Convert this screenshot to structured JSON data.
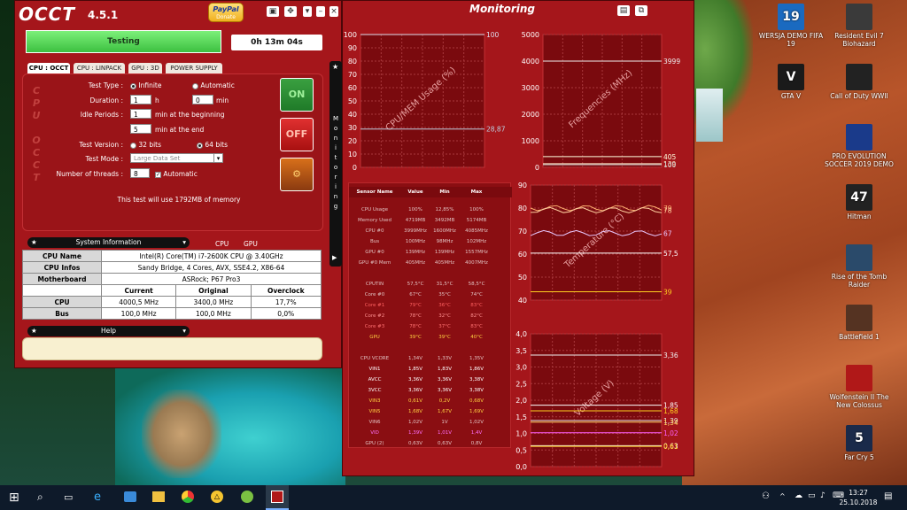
{
  "app": {
    "logo": "OCCT",
    "version": "4.5.1",
    "paypal_top": "PayPal",
    "paypal_bottom": "Donate"
  },
  "status": {
    "test_button": "Testing",
    "timer": "0h 13m 04s"
  },
  "tabs": [
    "CPU : OCCT",
    "CPU : LINPACK",
    "GPU : 3D",
    "POWER SUPPLY"
  ],
  "vertical_label": [
    "C",
    "P",
    "U",
    "",
    "O",
    "C",
    "C",
    "T"
  ],
  "form": {
    "test_type_label": "Test Type :",
    "infinite": "Infinite",
    "automatic": "Automatic",
    "duration_label": "Duration :",
    "duration_h": "1",
    "h": "h",
    "duration_min": "0",
    "min": "min",
    "idle_label": "Idle Periods :",
    "idle_begin": "1",
    "idle_begin_text": "min at the beginning",
    "idle_end": "5",
    "idle_end_text": "min at the end",
    "version_label": "Test Version :",
    "bits32": "32 bits",
    "bits64": "64 bits",
    "mode_label": "Test Mode :",
    "mode_value": "Large Data Set",
    "threads_label": "Number of threads :",
    "threads_value": "8",
    "threads_auto": "Automatic",
    "memory_note": "This test will use 1792MB of memory"
  },
  "buttons": {
    "on": "ON",
    "off": "OFF"
  },
  "monitoring_strip": [
    "M",
    "o",
    "n",
    "i",
    "t",
    "o",
    "r",
    "i",
    "n",
    "g"
  ],
  "sysinfo": {
    "title": "System Information",
    "cpu_tab": "CPU",
    "gpu_tab": "GPU",
    "rows": [
      [
        "CPU Name",
        "Intel(R) Core(TM) i7-2600K CPU @ 3.40GHz"
      ],
      [
        "CPU Infos",
        "Sandy Bridge, 4 Cores, AVX, SSE4.2, X86-64"
      ],
      [
        "Motherboard",
        "ASRock; P67 Pro3"
      ]
    ],
    "cols": [
      "Current",
      "Original",
      "Overclock"
    ],
    "data": [
      [
        "CPU",
        "4000,5 MHz",
        "3400,0 MHz",
        "17,7%"
      ],
      [
        "Bus",
        "100,0 MHz",
        "100,0 MHz",
        "0,0%"
      ]
    ]
  },
  "help": {
    "title": "Help"
  },
  "monitoring": {
    "title": "Monitoring"
  },
  "sensors": {
    "headers": [
      "Sensor Name",
      "Value",
      "Min",
      "Max"
    ],
    "rows": [
      [
        "CPU Usage",
        "100%",
        "12,85%",
        "100%"
      ],
      [
        "Memory Used",
        "4719MB",
        "3492MB",
        "5174MB"
      ],
      [
        "CPU #0",
        "3999MHz",
        "1600MHz",
        "4085MHz"
      ],
      [
        "Bus",
        "100MHz",
        "98MHz",
        "102MHz"
      ],
      [
        "GPU #0",
        "139MHz",
        "139MHz",
        "1557MHz"
      ],
      [
        "GPU #0 Mem",
        "405MHz",
        "405MHz",
        "4007MHz"
      ],
      [
        "",
        "",
        "",
        ""
      ],
      [
        "CPUTIN",
        "57,5°C",
        "31,5°C",
        "58,5°C"
      ],
      [
        "Core #0",
        "67°C",
        "35°C",
        "74°C"
      ],
      [
        "Core #1",
        "79°C",
        "36°C",
        "83°C"
      ],
      [
        "Core #2",
        "78°C",
        "32°C",
        "82°C"
      ],
      [
        "Core #3",
        "78°C",
        "37°C",
        "83°C"
      ],
      [
        "GPU",
        "39°C",
        "39°C",
        "40°C"
      ],
      [
        "",
        "",
        "",
        ""
      ],
      [
        "CPU VCORE",
        "1,34V",
        "1,33V",
        "1,35V"
      ],
      [
        "VIN1",
        "1,85V",
        "1,83V",
        "1,86V"
      ],
      [
        "AVCC",
        "3,36V",
        "3,36V",
        "3,38V"
      ],
      [
        "3VCC",
        "3,36V",
        "3,36V",
        "3,38V"
      ],
      [
        "VIN3",
        "0,61V",
        "0,2V",
        "0,68V"
      ],
      [
        "VIN5",
        "1,68V",
        "1,67V",
        "1,69V"
      ],
      [
        "VIN6",
        "1,02V",
        "1V",
        "1,02V"
      ],
      [
        "VID",
        "1,39V",
        "1,01V",
        "1,4V"
      ],
      [
        "GPU (2)",
        "0,63V",
        "0,63V",
        "0,8V"
      ]
    ]
  },
  "chart_data": [
    {
      "type": "line",
      "title": "CPU/MEM Usage (%)",
      "ylim": [
        0,
        100
      ],
      "yticks": [
        "100",
        "90",
        "80",
        "70",
        "60",
        "50",
        "40",
        "30",
        "20",
        "10",
        "0"
      ],
      "series": [
        {
          "name": "",
          "values": [
            100,
            100
          ]
        },
        {
          "name": "",
          "values": [
            28.87,
            28.87
          ]
        }
      ],
      "end_labels": [
        "100",
        "28,87"
      ]
    },
    {
      "type": "line",
      "title": "Frequencies (MHz)",
      "ylim": [
        0,
        5000
      ],
      "yticks": [
        "5000",
        "4000",
        "3000",
        "2000",
        "1000",
        "0"
      ],
      "series": [
        {
          "name": "",
          "values": [
            3999,
            3999
          ]
        },
        {
          "name": "",
          "values": [
            405,
            405
          ]
        },
        {
          "name": "",
          "values": [
            139,
            139
          ]
        },
        {
          "name": "",
          "values": [
            100,
            100
          ]
        }
      ],
      "end_labels": [
        "3999",
        "405",
        "139",
        "100"
      ]
    },
    {
      "type": "line",
      "title": "Temperature (°C)",
      "ylim": [
        35,
        90
      ],
      "yticks": [
        "90",
        "80",
        "70",
        "60",
        "50",
        "40"
      ],
      "series": [
        {
          "name": "",
          "values": [
            79,
            78
          ]
        },
        {
          "name": "",
          "values": [
            78,
            78
          ]
        },
        {
          "name": "",
          "values": [
            67,
            67
          ]
        },
        {
          "name": "",
          "values": [
            57.5,
            57.5
          ]
        },
        {
          "name": "",
          "values": [
            39,
            39
          ]
        }
      ],
      "end_labels": [
        "79",
        "78",
        "67",
        "57,5",
        "39"
      ]
    },
    {
      "type": "line",
      "title": "Voltage (V)",
      "ylim": [
        0,
        4
      ],
      "yticks": [
        "4,0",
        "3,5",
        "3,0",
        "2,5",
        "2,0",
        "1,5",
        "1,0",
        "0,5",
        "0,0"
      ],
      "series": [
        {
          "name": "",
          "values": [
            3.36,
            3.36
          ]
        },
        {
          "name": "",
          "values": [
            1.85,
            1.85
          ]
        },
        {
          "name": "",
          "values": [
            1.68,
            1.68
          ]
        },
        {
          "name": "",
          "values": [
            1.39,
            1.39
          ]
        },
        {
          "name": "",
          "values": [
            1.34,
            1.34
          ]
        },
        {
          "name": "",
          "values": [
            1.02,
            1.02
          ]
        },
        {
          "name": "",
          "values": [
            0.63,
            0.63
          ]
        },
        {
          "name": "",
          "values": [
            0.61,
            0.61
          ]
        }
      ],
      "end_labels": [
        "3,36",
        "1,85",
        "1,68",
        "1,39",
        "1,34",
        "1,02",
        "0,63",
        "0,61"
      ]
    }
  ],
  "desktop_icons": [
    {
      "label": "WERSJA DEMO FIFA 19",
      "color": "#1a6ac0",
      "glyph": "19"
    },
    {
      "label": "Resident Evil 7 Biohazard",
      "color": "#3a3a3a",
      "glyph": ""
    },
    {
      "label": "GTA V",
      "color": "#1a1a1a",
      "glyph": "V"
    },
    {
      "label": "Call of Duty WWII",
      "color": "#222",
      "glyph": ""
    },
    {
      "label": "PRO EVOLUTION SOCCER 2019 DEMO",
      "color": "#1a3a8a",
      "glyph": ""
    },
    {
      "label": "Hitman",
      "color": "#222",
      "glyph": "47"
    },
    {
      "label": "Rise of the Tomb Raider",
      "color": "#2a4a6a",
      "glyph": ""
    },
    {
      "label": "Battlefield 1",
      "color": "#553322",
      "glyph": ""
    },
    {
      "label": "Wolfenstein II The New Colossus",
      "color": "#b01818",
      "glyph": ""
    },
    {
      "label": "Far Cry 5",
      "color": "#1a2a4a",
      "glyph": "5"
    }
  ],
  "taskbar": {
    "time": "13:27",
    "date": "25.10.2018"
  }
}
